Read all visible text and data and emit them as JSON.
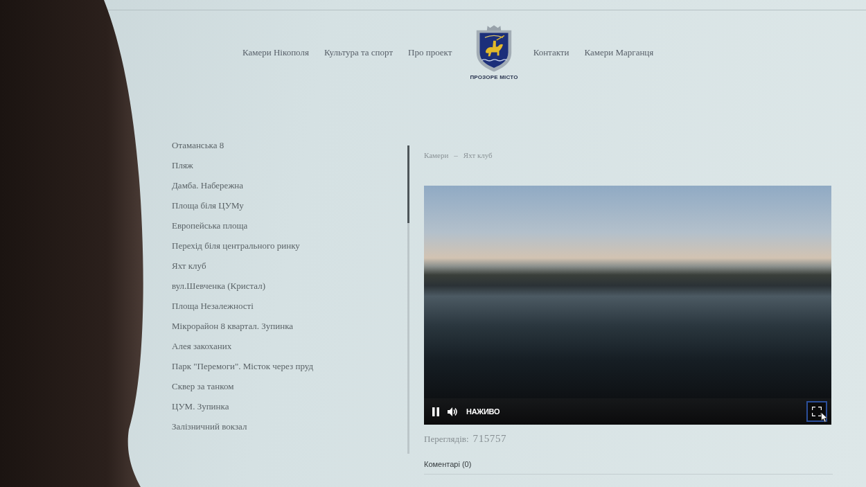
{
  "header": {
    "left_links": [
      "Камери Нікополя",
      "Культура та спорт",
      "Про проект"
    ],
    "logo_caption": "ПРОЗОРЕ МІСТО",
    "right_links": [
      "Контакти",
      "Камери Марганця"
    ]
  },
  "sidebar": {
    "items": [
      "Отаманська 8",
      "Пляж",
      "Дамба. Набережна",
      "Площа біля ЦУМу",
      "Европейська площа",
      "Перехід біля центрального ринку",
      "Яхт клуб",
      "вул.Шевченка (Кристал)",
      "Площа Незалежності",
      "Мікрорайон 8 квартал. Зупинка",
      "Алея закоханих",
      "Парк \"Перемоги\". Місток через пруд",
      "Сквер за танком",
      "ЦУМ. Зупинка",
      "Залізничний вокзал"
    ]
  },
  "breadcrumb": {
    "items": [
      "Камери",
      "Яхт клуб"
    ],
    "separator": "–"
  },
  "player": {
    "playing": true,
    "muted": false,
    "live_label": "НАЖИВО"
  },
  "views": {
    "label": "Переглядів:",
    "count": "715757"
  },
  "comments": {
    "label": "Коментарі (0)"
  }
}
